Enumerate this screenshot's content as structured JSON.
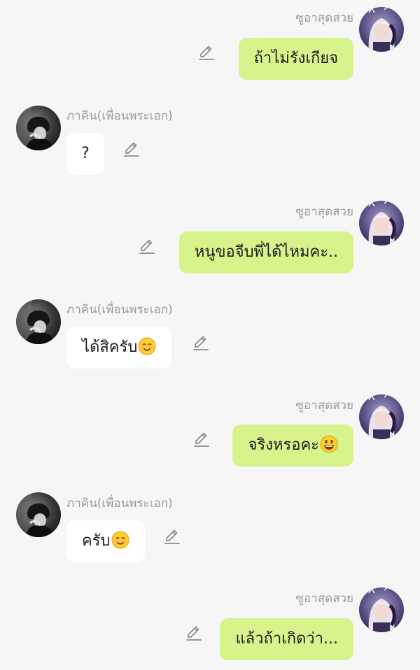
{
  "participants": {
    "me": {
      "name": "ซูอาสุดสวย",
      "avatar_icon": "girl-avatar"
    },
    "them": {
      "name": "ภาคิน(เพื่อนพระเอก)",
      "avatar_icon": "boy-avatar"
    }
  },
  "colors": {
    "background": "#f6f6f6",
    "my_bubble": "#d7f38c",
    "their_bubble": "#ffffff",
    "sender_text": "#9a9a9a",
    "edit_icon": "#8a8a8a"
  },
  "messages": [
    {
      "from": "me",
      "sender": "ซูอาสุดสวย",
      "text": "ถ้าไม่รังเกียจ",
      "emoji": ""
    },
    {
      "from": "them",
      "sender": "ภาคิน(เพื่อนพระเอก)",
      "text": "?",
      "emoji": ""
    },
    {
      "from": "me",
      "sender": "ซูอาสุดสวย",
      "text": "หนูขอจีบพี่ได้ไหมคะ..",
      "emoji": ""
    },
    {
      "from": "them",
      "sender": "ภาคิน(เพื่อนพระเอก)",
      "text": "ได้สิครับ",
      "emoji": "smiling-face-icon"
    },
    {
      "from": "me",
      "sender": "ซูอาสุดสวย",
      "text": "จริงหรอคะ",
      "emoji": "grinning-face-icon"
    },
    {
      "from": "them",
      "sender": "ภาคิน(เพื่อนพระเอก)",
      "text": "ครับ",
      "emoji": "smiling-face-icon"
    },
    {
      "from": "me",
      "sender": "ซูอาสุดสวย",
      "text": "แล้วถ้าเกิดว่า...",
      "emoji": ""
    }
  ],
  "edit_action_icon": "pencil-edit-icon"
}
